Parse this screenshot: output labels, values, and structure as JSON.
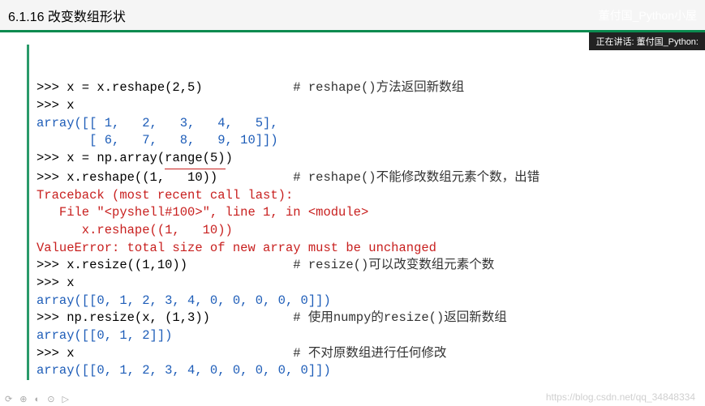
{
  "header": {
    "title_fragment": "6.1.16  改变数组形状",
    "author": "董付国_Python小屋"
  },
  "badge": "正在讲话: 董付国_Python:",
  "code": {
    "l1_code": ">>> x = x.reshape(2,5)            ",
    "l1_comment": "# reshape()方法返回新数组",
    "l2": ">>> x",
    "l3a": "array([[ 1,   2,   3,   4,   5],",
    "l3b": "       [ 6,   7,   8,   9, 10]])",
    "l4a": ">>> x = np.array(",
    "l4b_underlined": "range(5)",
    "l4c": ")",
    "l5_code": ">>> x.reshape((1,   10))          ",
    "l5_comment": "# reshape()不能修改数组元素个数，出错",
    "l6": "Traceback (most recent call last):",
    "l7": "   File \"<pyshell#100>\", line 1, in <module>",
    "l8": "      x.reshape((1,   10))",
    "l9": "ValueError: total size of new array must be unchanged",
    "l10_code": ">>> x.resize((1,10))              ",
    "l10_comment": "# resize()可以改变数组元素个数",
    "l11": ">>> x",
    "l12": "array([[0, 1, 2, 3, 4, 0, 0, 0, 0, 0]])",
    "l13_code": ">>> np.resize(x, (1,3))           ",
    "l13_comment": "# 使用numpy的resize()返回新数组",
    "l14": "array([[0, 1, 2]])",
    "l15_code": ">>> x                             ",
    "l15_comment": "# 不对原数组进行任何修改",
    "l16": "array([[0, 1, 2, 3, 4, 0, 0, 0, 0, 0]])"
  },
  "watermark": "https://blog.csdn.net/qq_34848334",
  "footer_icons": "⟳ ⊕ ◐ ⊙ ▷"
}
